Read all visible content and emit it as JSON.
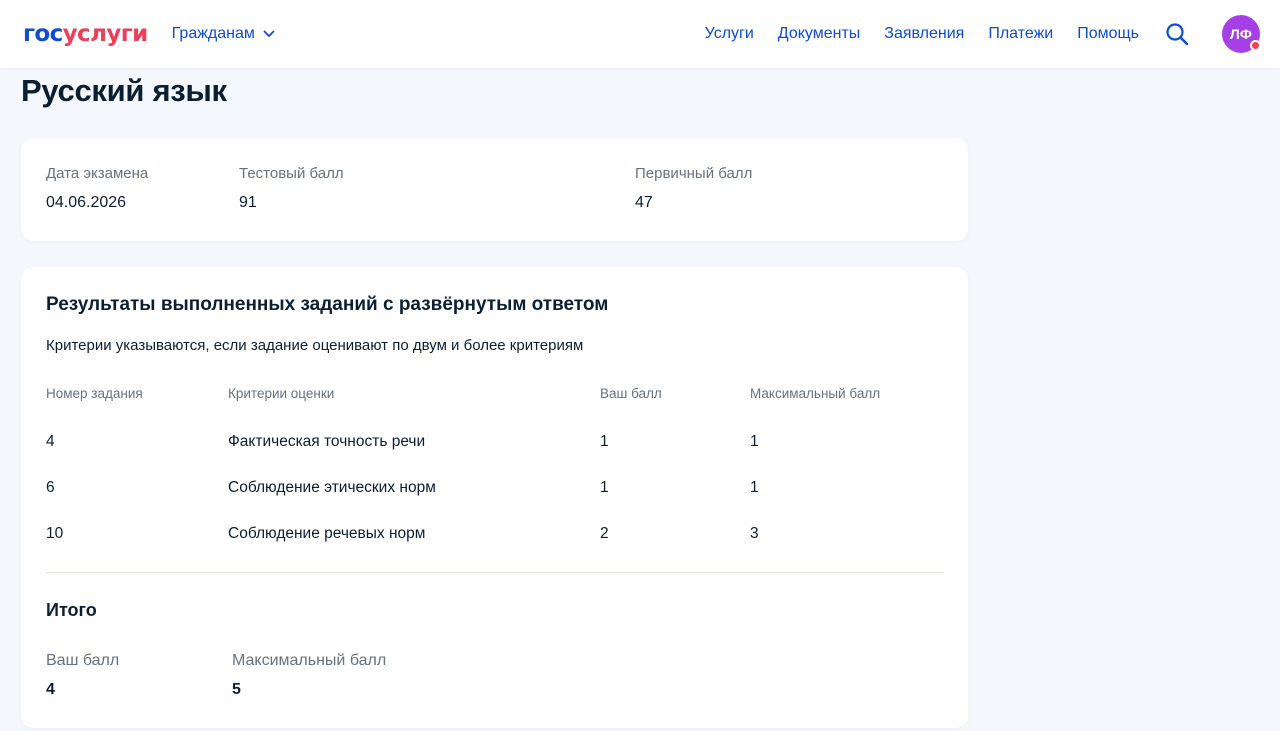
{
  "header": {
    "logo_part1": "гос",
    "logo_part2": "услуги",
    "audience_label": "Гражданам",
    "nav": [
      "Услуги",
      "Документы",
      "Заявления",
      "Платежи",
      "Помощь"
    ],
    "avatar_initials": "ЛФ",
    "accent_color": "#0d4cd3",
    "brand_red": "#ee3f58",
    "avatar_color": "#a440e5"
  },
  "page": {
    "title": "Русский язык"
  },
  "summary": {
    "exam_date_label": "Дата экзамена",
    "exam_date": "04.06.2026",
    "test_score_label": "Тестовый балл",
    "test_score": "91",
    "primary_score_label": "Первичный балл",
    "primary_score": "47"
  },
  "results": {
    "title": "Результаты выполненных заданий с развёрнутым ответом",
    "note": "Критерии указываются, если задание оценивают по двум и более критериям",
    "columns": [
      "Номер задания",
      "Критерии оценки",
      "Ваш балл",
      "Максимальный балл"
    ],
    "rows": [
      [
        "4",
        "Фактическая точность речи",
        "1",
        "1"
      ],
      [
        "6",
        "Соблюдение этических норм",
        "1",
        "1"
      ],
      [
        "10",
        "Соблюдение речевых норм",
        "2",
        "3"
      ]
    ],
    "total": {
      "title": "Итого",
      "your_score_label": "Ваш балл",
      "your_score": "4",
      "max_score_label": "Максимальный балл",
      "max_score": "5"
    }
  }
}
